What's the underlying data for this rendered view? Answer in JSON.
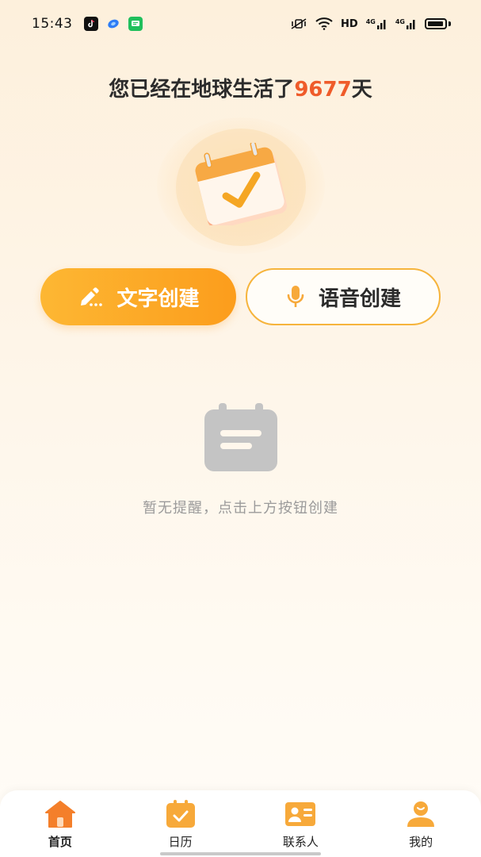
{
  "status_bar": {
    "time": "15:43",
    "apps": [
      "tiktok-icon",
      "browser-icon",
      "message-icon"
    ],
    "right_text": "HD",
    "signal_labels": [
      "4G",
      "4G"
    ]
  },
  "headline": {
    "prefix": "您已经在地球生活了",
    "days": "9677",
    "suffix": "天",
    "days_color": "#ef5b2a"
  },
  "hero": {
    "icon": "calendar-check-icon"
  },
  "actions": {
    "text_create": "文字创建",
    "voice_create": "语音创建",
    "accent_color": "#fca41f"
  },
  "empty_state": {
    "icon": "empty-calendar-icon",
    "message": "暂无提醒，点击上方按钮创建"
  },
  "tabbar": {
    "items": [
      {
        "label": "首页",
        "icon": "home-icon",
        "active": true
      },
      {
        "label": "日历",
        "icon": "calendar-icon",
        "active": false
      },
      {
        "label": "联系人",
        "icon": "contact-card-icon",
        "active": false
      },
      {
        "label": "我的",
        "icon": "user-icon",
        "active": false
      }
    ]
  }
}
